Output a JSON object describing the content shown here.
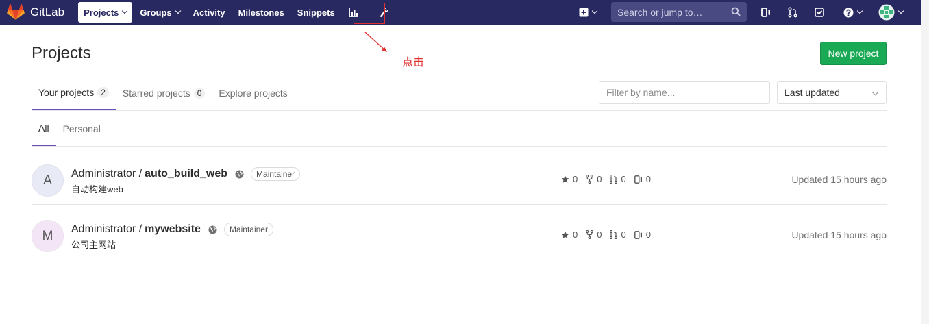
{
  "app": {
    "brand_name": "GitLab"
  },
  "nav": {
    "items": [
      {
        "label": "Projects",
        "dropdown": true,
        "active": true
      },
      {
        "label": "Groups",
        "dropdown": true,
        "active": false
      },
      {
        "label": "Activity",
        "dropdown": false,
        "active": false
      },
      {
        "label": "Milestones",
        "dropdown": false,
        "active": false
      },
      {
        "label": "Snippets",
        "dropdown": false,
        "active": false
      }
    ],
    "icons": [
      "chart-icon",
      "admin-wrench-icon",
      "plus-square-icon",
      "issues-icon",
      "merge-request-icon",
      "todo-check-icon",
      "help-icon",
      "user-avatar-icon"
    ],
    "search_placeholder": "Search or jump to…"
  },
  "annotation": {
    "text": "点击",
    "color": "#e0302e"
  },
  "page": {
    "title": "Projects",
    "new_project_label": "New project",
    "tabs": [
      {
        "label": "Your projects",
        "count": "2",
        "active": true
      },
      {
        "label": "Starred projects",
        "count": "0",
        "active": false
      },
      {
        "label": "Explore projects",
        "count": "",
        "active": false
      }
    ],
    "filter_placeholder": "Filter by name...",
    "sort_value": "Last updated",
    "subtabs": [
      {
        "label": "All",
        "active": true
      },
      {
        "label": "Personal",
        "active": false
      }
    ]
  },
  "projects": [
    {
      "avatar_letter": "A",
      "namespace": "Administrator /",
      "name": "auto_build_web",
      "role": "Maintainer",
      "description": "自动构建web",
      "stars": "0",
      "forks": "0",
      "merge_requests": "0",
      "issues": "0",
      "updated": "Updated 15 hours ago"
    },
    {
      "avatar_letter": "M",
      "namespace": "Administrator /",
      "name": "mywebsite",
      "role": "Maintainer",
      "description": "公司主网站",
      "stars": "0",
      "forks": "0",
      "merge_requests": "0",
      "issues": "0",
      "updated": "Updated 15 hours ago"
    }
  ],
  "colors": {
    "navbar": "#292961",
    "accent_green": "#1aaa55",
    "tab_underline": "#6b4fbb",
    "annotation_red": "#e0302e"
  }
}
